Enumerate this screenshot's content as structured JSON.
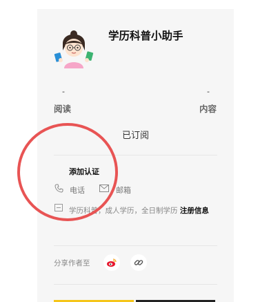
{
  "author": {
    "name": "学历科普小助手"
  },
  "stats": [
    {
      "value": "-",
      "label": "阅读"
    },
    {
      "value": "-",
      "label": "内容"
    }
  ],
  "subscribe": {
    "label": "已订阅"
  },
  "certification": {
    "label": "添加认证"
  },
  "contact": {
    "phone_label": "电话",
    "email_label": "邮箱"
  },
  "description": {
    "text": "学历科普，成人学历，全日制学历",
    "link": "注册信息"
  },
  "share": {
    "label": "分享作者至"
  },
  "colors": {
    "annotation": "#e85454",
    "accent": "#f5c518",
    "weibo": "#e6162d"
  },
  "icons": [
    "avatar",
    "phone-icon",
    "mail-icon",
    "info-card-icon",
    "weibo-icon",
    "link-icon"
  ]
}
